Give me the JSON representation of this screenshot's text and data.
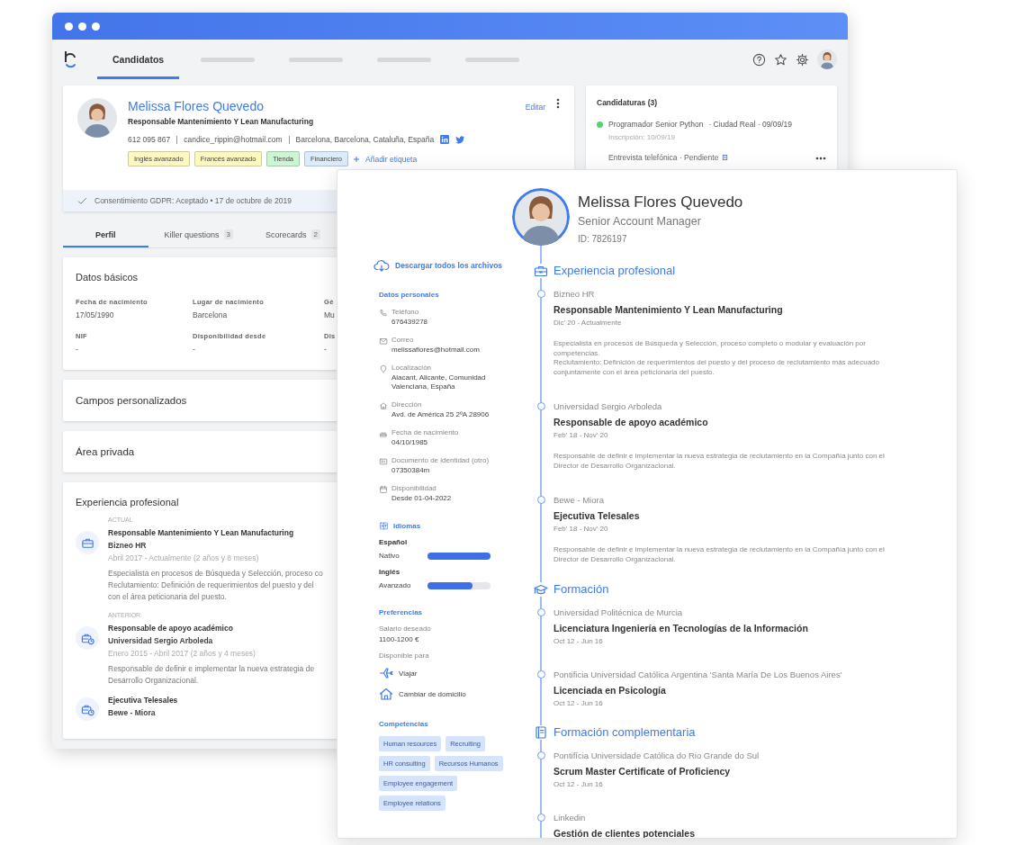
{
  "back_window": {
    "nav_tabs": [
      {
        "label": "Candidatos",
        "selected": true
      }
    ],
    "candidate": {
      "name": "Melissa Flores Quevedo",
      "headline": "Responsable Mantenimiento Y Lean Manufacturing",
      "contact": [
        "612 095 867",
        "candice_rippin@hotmail.com",
        "Barcelona, Barcelona, Cataluña, España"
      ],
      "edit": "Editar",
      "tags": [
        {
          "label": "Inglés avanzado",
          "color": "#fdf7c0"
        },
        {
          "label": "Francés avanzado",
          "color": "#fdf7c0"
        },
        {
          "label": "Tienda",
          "color": "#cbf5d3"
        },
        {
          "label": "Financiero",
          "color": "#dcecfd"
        }
      ],
      "add_tag": "Añadir etiqueta",
      "gdpr": "Consentimiento GDPR: Aceptado • 17 de octubre de 2019"
    },
    "profile_tabs": [
      {
        "label": "Perfil",
        "selected": true
      },
      {
        "label": "Killer questions",
        "count": "3",
        "selected": false
      },
      {
        "label": "Scorecards",
        "count": "2",
        "selected": false
      }
    ],
    "basic_data": {
      "title": "Datos básicos",
      "fields": [
        {
          "label": "Fecha de nacimiento",
          "value": "17/05/1990"
        },
        {
          "label": "Lugar de nacimiento",
          "value": "Barcelona"
        },
        {
          "label": "Gé",
          "value": "Mu"
        },
        {
          "label": "NIF",
          "value": "-"
        },
        {
          "label": "Disponibilidad desde",
          "value": "-"
        },
        {
          "label": "Dis",
          "value": "-"
        }
      ]
    },
    "collapsed_sections": [
      {
        "title": "Campos personalizados"
      },
      {
        "title": "Área privada"
      }
    ],
    "experience": {
      "title": "Experiencia profesional",
      "items": [
        {
          "kind": "current",
          "period": "ACTUAL",
          "title": "Responsable Mantenimiento Y Lean Manufacturing",
          "company": "Bizneo HR",
          "dates": "Abril 2017 - Actualmente (2 años y 8 meses)",
          "description": "Especialista en procesos de Búsqueda y Selección, proceso co\nReclutamiento: Definición de requerimientos del puesto y del\ncon el área peticionaria del puesto."
        },
        {
          "kind": "past",
          "period": "ANTERIOR",
          "title": "Responsable de apoyo académico",
          "company": "Universidad Sergio Arboleda",
          "dates": "Enero 2015 - Abril 2017 (2 años y 4 meses)",
          "description": "Responsable de definir e implementar la nueva estrategia de\nDesarrollo Organizacional."
        },
        {
          "kind": "past",
          "title": "Ejecutiva Telesales",
          "company": "Bewe - Miora"
        }
      ]
    },
    "applications": {
      "title": "Candidaturas (3)",
      "items": [
        {
          "job": "Programador Senior Python",
          "details": "· Ciudad Real · 09/09/19",
          "color": "#4cd964",
          "inscription": "Inscripción: 10/09/19",
          "stage": "Entrevista telefónica · Pendiente"
        }
      ]
    }
  },
  "cv": {
    "name": "Melissa Flores Quevedo",
    "role": "Senior Account Manager",
    "id": "ID: 7826197",
    "download": "Descargar todos los archivos",
    "personal": {
      "title": "Datos personales",
      "fields": [
        {
          "kind": "phone",
          "label": "Teléfono",
          "value": "676439278"
        },
        {
          "kind": "mail",
          "label": "Correo",
          "value": "melissaflores@hotmail.com"
        },
        {
          "kind": "location",
          "label": "Localización",
          "value": "Alacant, Alicante, Comunidad Valenciana, España"
        },
        {
          "kind": "home",
          "label": "Dirección",
          "value": "Avd. de América 25 2ºA 28906"
        },
        {
          "kind": "birthday",
          "label": "Fecha de nacimiento",
          "value": "04/10/1985"
        },
        {
          "kind": "id",
          "label": "Documento de identidad (otro)",
          "value": "07350384m"
        },
        {
          "kind": "calendar",
          "label": "Disponibilidad",
          "value": "Desde 01-04-2022"
        }
      ]
    },
    "languages": {
      "title": "Idiomas",
      "items": [
        {
          "name": "Español",
          "level_label": "Nativo",
          "level": 1
        },
        {
          "name": "Inglés",
          "level_label": "Avanzado",
          "level": 0.72
        }
      ]
    },
    "preferences": {
      "title": "Preferencias",
      "salary_label": "Salario deseado",
      "salary": "1100-1200 €",
      "availability_label": "Disponible para",
      "options": [
        {
          "kind": "travel",
          "label": "Viajar"
        },
        {
          "kind": "relocate",
          "label": "Cambiar de domicilio"
        }
      ]
    },
    "skills": {
      "title": "Competencias",
      "tags": [
        "Human resources",
        "Recruiting",
        "HR consulting",
        "Recursos Humanos",
        "Employee engagement",
        "Employee relations"
      ]
    },
    "sections": [
      {
        "kind": "work",
        "title": "Experiencia profesional",
        "entries": [
          {
            "org": "Bizneo HR",
            "title": "Responsable Mantenimiento Y Lean Manufacturing",
            "dates": "Dic' 20 - Actualmente",
            "description": "Especialista en procesos de Búsqueda y Selección, proceso completo o modular y evaluación por competencias.\nReclutamiento: Definición de requerimientos del puesto y del proceso de reclutamiento más adecuado conjuntamente con el área peticionaria del puesto."
          },
          {
            "org": "Universidad Sergio Arboleda",
            "title": "Responsable de apoyo académico",
            "dates": "Feb' 18 - Nov' 20",
            "description": "Responsable de definir e implementar la nueva estrategia de reclutamiento en la Compañía junto con el Director de Desarrollo Organizacional."
          },
          {
            "org": "Bewe - Miora",
            "title": "Ejecutiva Telesales",
            "dates": "Feb' 18 - Nov' 20",
            "description": "Responsable de definir e implementar la nueva estrategia de reclutamiento en la Compañía junto con el Director de Desarrollo Organizacional."
          }
        ]
      },
      {
        "kind": "education",
        "title": "Formación",
        "entries": [
          {
            "org": "Universidad Politécnica de Murcia",
            "title": "Licenciatura Ingeniería en Tecnologías de la Información",
            "dates": "Oct 12 - Jun 16"
          },
          {
            "org": "Pontificia Universidad Católica Argentina 'Santa María De Los Buenos Aires'",
            "title": "Licenciada en Psicología",
            "dates": "Oct 12 - Jun 16"
          }
        ]
      },
      {
        "kind": "courses",
        "title": "Formación complementaria",
        "entries": [
          {
            "org": "Pontifícia Universidade Católica do Rio Grande do Sul",
            "title": "Scrum Master Certificate of Proficiency",
            "dates": "Oct 12 - Jun 16"
          },
          {
            "org": "Linkedin",
            "title": "Gestión de clientes potenciales"
          }
        ]
      }
    ]
  }
}
